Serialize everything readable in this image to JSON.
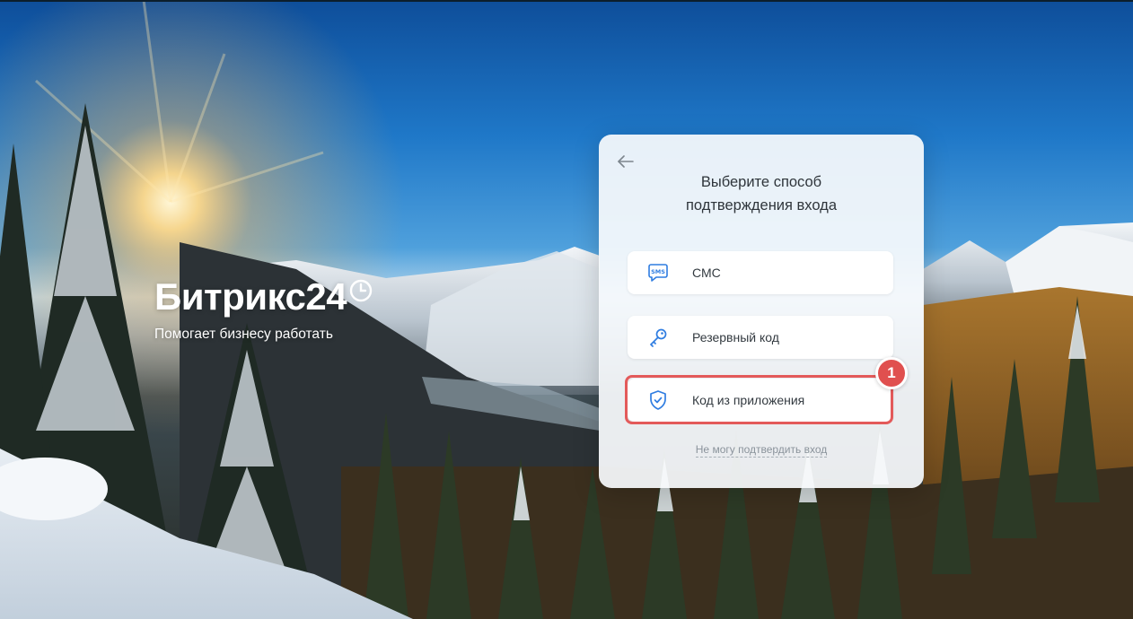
{
  "brand": {
    "name": "Битрикс24",
    "tagline": "Помогает бизнесу работать"
  },
  "card": {
    "title_line1": "Выберите способ",
    "title_line2": "подтверждения входа",
    "options": [
      {
        "label": "СМС",
        "icon": "sms-icon"
      },
      {
        "label": "Резервный код",
        "icon": "key-icon"
      },
      {
        "label": "Код из приложения",
        "icon": "shield-check-icon"
      }
    ],
    "cant_confirm_link": "Не могу подтвердить вход"
  },
  "annotation": {
    "step_number": "1",
    "color": "#e35a5a"
  },
  "colors": {
    "icon_accent": "#2f7de1",
    "card_background": "#f8fafc"
  }
}
